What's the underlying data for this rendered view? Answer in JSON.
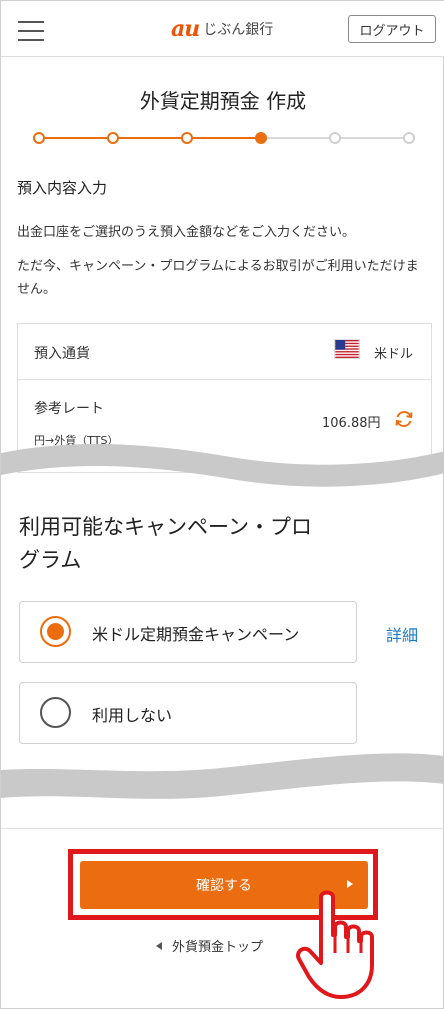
{
  "header": {
    "brand_au": "au",
    "brand_name": "じぶん銀行",
    "logout_label": "ログアウト"
  },
  "page": {
    "title": "外貨定期預金 作成",
    "steps_total": 6,
    "current_step": 4,
    "section_heading": "預入内容入力",
    "description_1": "出金口座をご選択のうえ預入金額などをご入力ください。",
    "description_2": "ただ今、キャンペーン・プログラムによるお取引がご利用いただけません。"
  },
  "currency_card": {
    "currency_label": "預入通貨",
    "currency_value": "米ドル",
    "flag_icon": "us-flag-icon",
    "rate_label": "参考レート",
    "rate_sub": "円→外貨（TTS）",
    "rate_value": "106.88円"
  },
  "campaign": {
    "title": "利用可能なキャンペーン・プログラム",
    "options": [
      {
        "label": "米ドル定期預金キャンペーン",
        "selected": true
      },
      {
        "label": "利用しない",
        "selected": false
      }
    ],
    "detail_label": "詳細"
  },
  "footer": {
    "confirm_label": "確認する",
    "back_label": "外貨預金トップ"
  },
  "colors": {
    "accent": "#eb6d0f",
    "highlight": "#e0171b",
    "link": "#1b7cc6"
  }
}
